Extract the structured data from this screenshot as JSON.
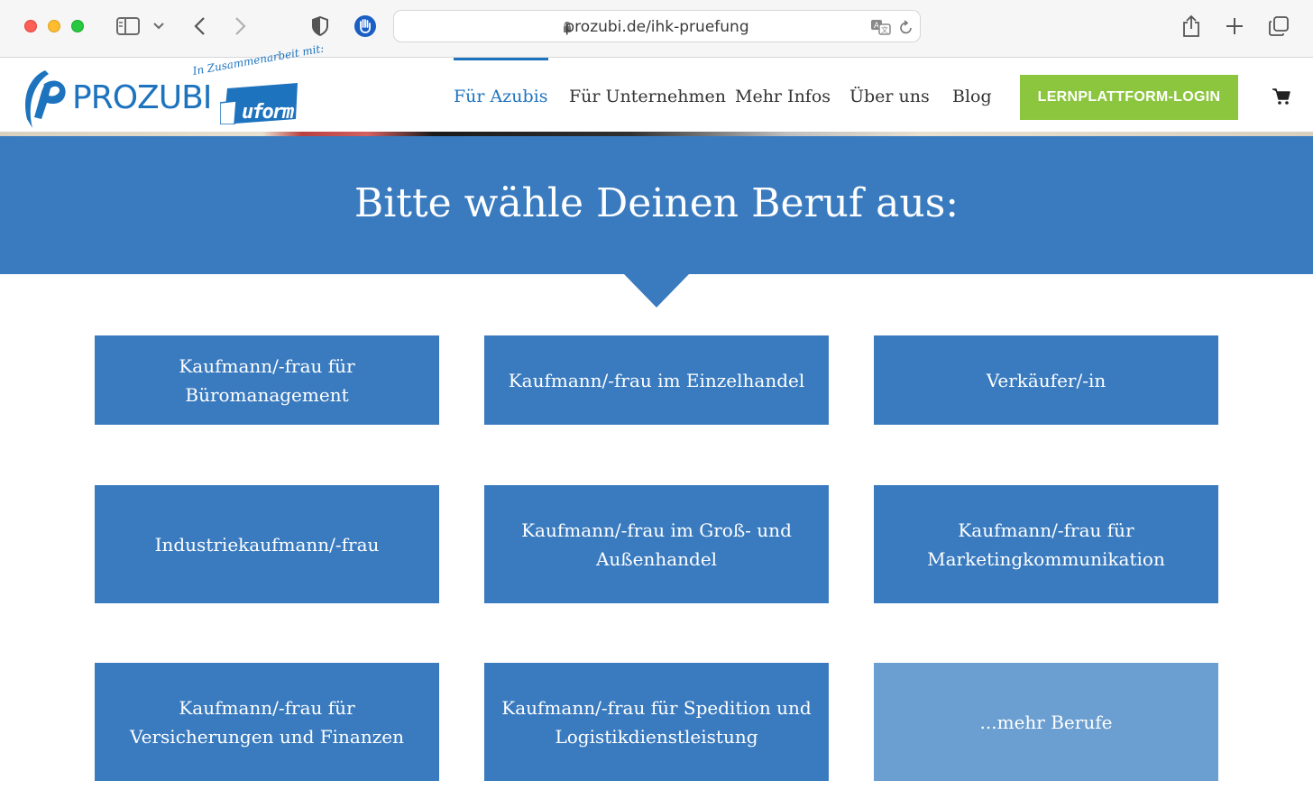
{
  "browser": {
    "url": "prozubi.de/ihk-pruefung"
  },
  "site": {
    "logo_text": "PROZUBI",
    "logo_coop": "In Zusammenarbeit mit:",
    "partner_logo": "uform",
    "nav": [
      {
        "label": "Für Azubis"
      },
      {
        "label": "Für Unternehmen"
      },
      {
        "label": "Mehr Infos"
      },
      {
        "label": "Über uns"
      },
      {
        "label": "Blog"
      }
    ],
    "login_label": "LERNPLATTFORM-LOGIN",
    "brand_color": "#1e73be",
    "login_color": "#8cc63f"
  },
  "hero": {
    "title": "Bitte wähle Deinen Beruf aus:",
    "color": "#3a7bbf"
  },
  "tiles": [
    {
      "label": "Kaufmann/-frau für Büromanagement"
    },
    {
      "label": "Kaufmann/-frau im Einzelhandel"
    },
    {
      "label": "Verkäufer/-in"
    },
    {
      "label": "Industriekaufmann/-frau"
    },
    {
      "label": "Kaufmann/-frau im Groß- und Außenhandel"
    },
    {
      "label": "Kaufmann/-frau für Marketingkommunikation"
    },
    {
      "label": "Kaufmann/-frau für Versicherungen und Finanzen"
    },
    {
      "label": "Kaufmann/-frau für Spedition und Logistikdienstleistung"
    },
    {
      "label": "...mehr Berufe"
    }
  ]
}
